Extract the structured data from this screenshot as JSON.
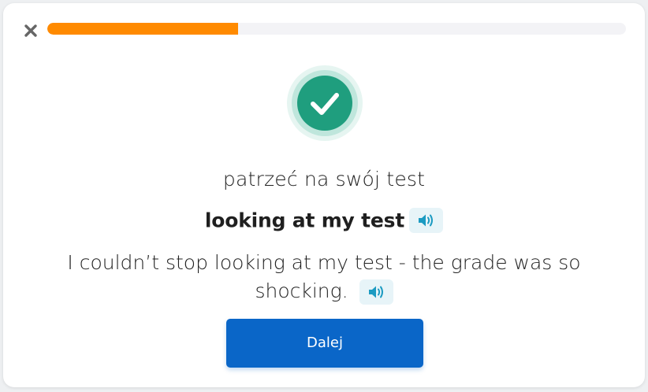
{
  "header": {
    "close_icon": "close-icon",
    "progress_fraction": 0.33
  },
  "result": {
    "status_icon": "check-circle-icon",
    "status_color": "#1f9e7e",
    "prompt_text": "patrzeć na swój test",
    "answer_text": "looking at my test",
    "example_sentence": "I couldn’t stop looking at my test - the grade was so shocking.",
    "audio_icon": "speaker-icon"
  },
  "footer": {
    "next_label": "Dalej",
    "next_color": "#0a66c8"
  },
  "colors": {
    "progress": "#ff8a00",
    "audio_bg": "#e7f4f8",
    "audio_icon": "#1c9bc2"
  }
}
